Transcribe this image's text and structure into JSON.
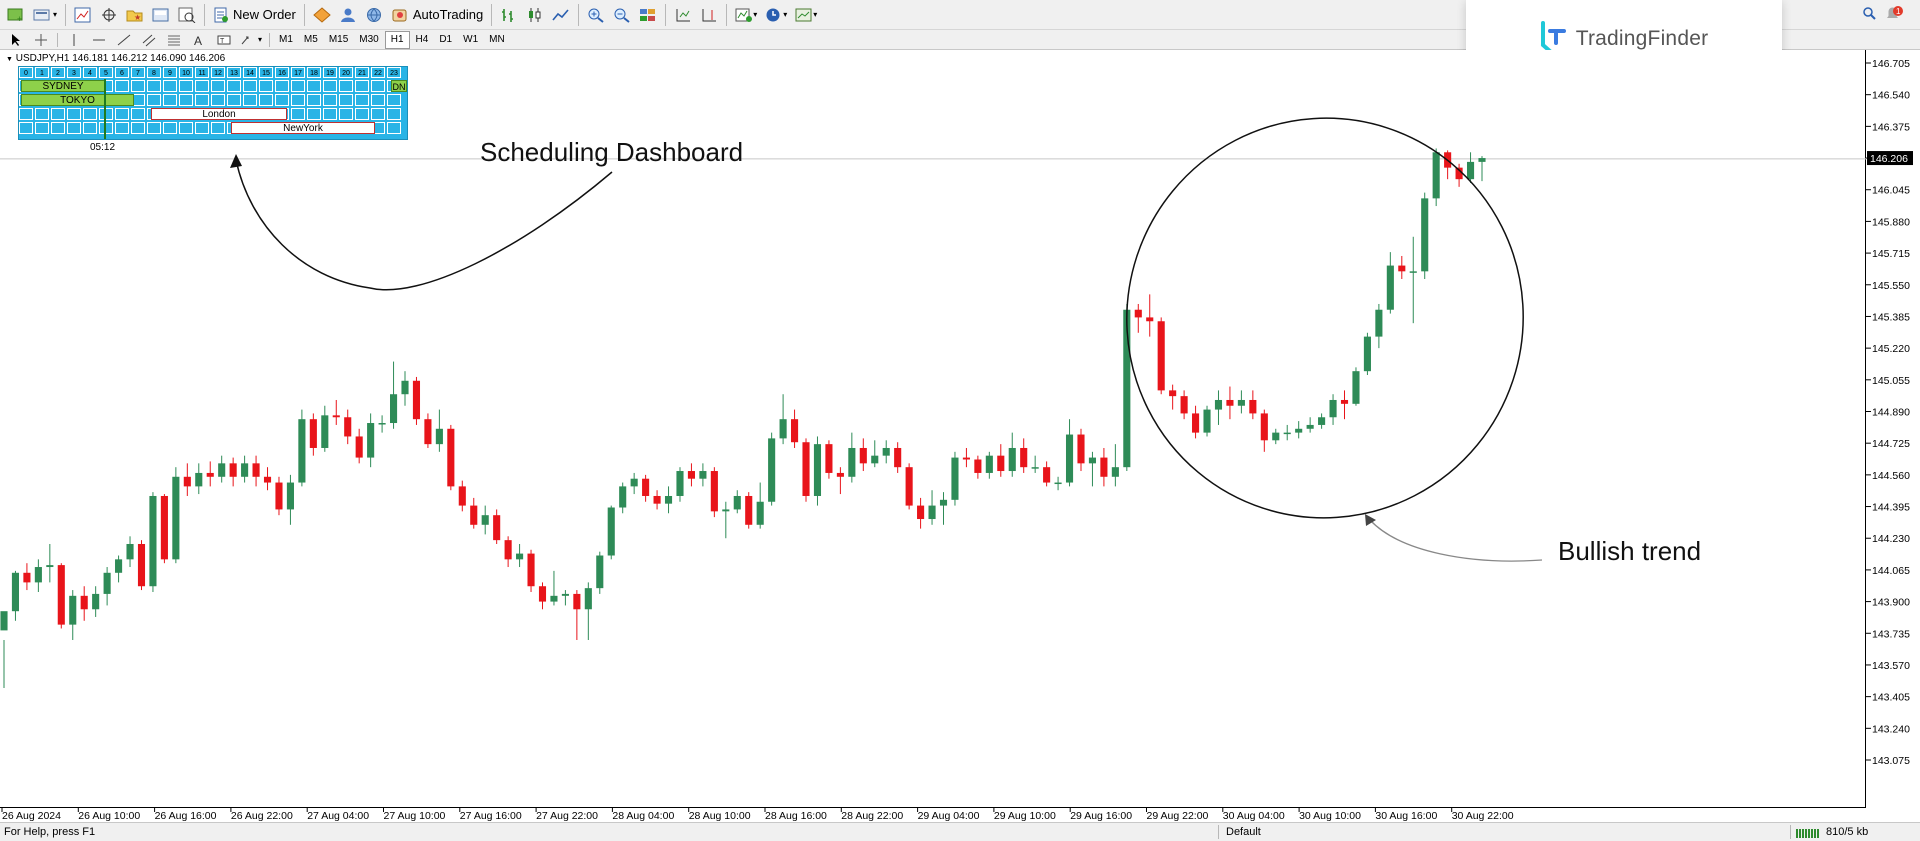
{
  "toolbar": {
    "new_order_label": "New Order",
    "autotrading_label": "AutoTrading",
    "timeframes": [
      "M1",
      "M5",
      "M15",
      "M30",
      "H1",
      "H4",
      "D1",
      "W1",
      "MN"
    ],
    "active_timeframe": "H1",
    "notification_count": "1"
  },
  "logo": {
    "text": "TradingFinder"
  },
  "chart": {
    "symbol_line": "USDJPY,H1  146.181 146.212 146.090 146.206",
    "current_price": "146.206",
    "price_labels": [
      "146.705",
      "146.540",
      "146.375",
      "146.206",
      "146.045",
      "145.880",
      "145.715",
      "145.550",
      "145.385",
      "145.220",
      "145.055",
      "144.890",
      "144.725",
      "144.560",
      "144.395",
      "144.230",
      "144.065",
      "143.900",
      "143.735",
      "143.570",
      "143.405",
      "143.240",
      "143.075"
    ],
    "time_labels": [
      "26 Aug 2024",
      "26 Aug 10:00",
      "26 Aug 16:00",
      "26 Aug 22:00",
      "27 Aug 04:00",
      "27 Aug 10:00",
      "27 Aug 16:00",
      "27 Aug 22:00",
      "28 Aug 04:00",
      "28 Aug 10:00",
      "28 Aug 16:00",
      "28 Aug 22:00",
      "29 Aug 04:00",
      "29 Aug 10:00",
      "29 Aug 16:00",
      "29 Aug 22:00",
      "30 Aug 04:00",
      "30 Aug 10:00",
      "30 Aug 16:00",
      "30 Aug 22:00"
    ],
    "colors": {
      "bull": "#2e8b57",
      "bear": "#e8141a"
    },
    "candles": [
      [
        143.75,
        143.85,
        143.7,
        143.45
      ],
      [
        143.85,
        144.05,
        144.06,
        143.8
      ],
      [
        144.05,
        144.0,
        144.1,
        143.96
      ],
      [
        144.0,
        144.08,
        144.12,
        143.95
      ],
      [
        144.08,
        144.09,
        144.2,
        144.0
      ],
      [
        144.09,
        143.78,
        144.1,
        143.76
      ],
      [
        143.78,
        143.93,
        143.96,
        143.7
      ],
      [
        143.93,
        143.86,
        143.98,
        143.8
      ],
      [
        143.86,
        143.94,
        143.98,
        143.82
      ],
      [
        143.94,
        144.05,
        144.08,
        143.88
      ],
      [
        144.05,
        144.12,
        144.14,
        144.0
      ],
      [
        144.12,
        144.2,
        144.24,
        144.08
      ],
      [
        144.2,
        143.98,
        144.22,
        143.96
      ],
      [
        143.98,
        144.45,
        144.47,
        143.95
      ],
      [
        144.45,
        144.12,
        144.46,
        144.1
      ],
      [
        144.12,
        144.55,
        144.6,
        144.1
      ],
      [
        144.55,
        144.5,
        144.62,
        144.45
      ],
      [
        144.5,
        144.57,
        144.62,
        144.46
      ],
      [
        144.57,
        144.55,
        144.63,
        144.5
      ],
      [
        144.55,
        144.62,
        144.66,
        144.52
      ],
      [
        144.62,
        144.55,
        144.65,
        144.5
      ],
      [
        144.55,
        144.62,
        144.66,
        144.52
      ],
      [
        144.62,
        144.55,
        144.66,
        144.5
      ],
      [
        144.55,
        144.52,
        144.6,
        144.48
      ],
      [
        144.52,
        144.38,
        144.55,
        144.35
      ],
      [
        144.38,
        144.52,
        144.56,
        144.3
      ],
      [
        144.52,
        144.85,
        144.9,
        144.5
      ],
      [
        144.85,
        144.7,
        144.88,
        144.66
      ],
      [
        144.7,
        144.87,
        144.92,
        144.68
      ],
      [
        144.87,
        144.86,
        144.95,
        144.82
      ],
      [
        144.86,
        144.76,
        144.9,
        144.72
      ],
      [
        144.76,
        144.65,
        144.8,
        144.62
      ],
      [
        144.65,
        144.83,
        144.88,
        144.6
      ],
      [
        144.83,
        144.83,
        144.87,
        144.78
      ],
      [
        144.83,
        144.98,
        145.15,
        144.8
      ],
      [
        144.98,
        145.05,
        145.1,
        144.92
      ],
      [
        145.05,
        144.85,
        145.07,
        144.82
      ],
      [
        144.85,
        144.72,
        144.88,
        144.7
      ],
      [
        144.72,
        144.8,
        144.9,
        144.68
      ],
      [
        144.8,
        144.5,
        144.82,
        144.48
      ],
      [
        144.5,
        144.4,
        144.53,
        144.37
      ],
      [
        144.4,
        144.3,
        144.44,
        144.28
      ],
      [
        144.3,
        144.35,
        144.4,
        144.25
      ],
      [
        144.35,
        144.22,
        144.38,
        144.2
      ],
      [
        144.22,
        144.12,
        144.24,
        144.08
      ],
      [
        144.12,
        144.15,
        144.2,
        144.08
      ],
      [
        144.15,
        143.98,
        144.17,
        143.95
      ],
      [
        143.98,
        143.9,
        144.0,
        143.86
      ],
      [
        143.9,
        143.93,
        144.06,
        143.88
      ],
      [
        143.93,
        143.94,
        143.96,
        143.88
      ],
      [
        143.94,
        143.86,
        143.96,
        143.7
      ],
      [
        143.86,
        143.97,
        144.0,
        143.7
      ],
      [
        143.97,
        144.14,
        144.16,
        143.94
      ],
      [
        144.14,
        144.39,
        144.4,
        144.12
      ],
      [
        144.39,
        144.5,
        144.52,
        144.36
      ],
      [
        144.5,
        144.54,
        144.57,
        144.46
      ],
      [
        144.54,
        144.45,
        144.56,
        144.42
      ],
      [
        144.45,
        144.41,
        144.48,
        144.38
      ],
      [
        144.41,
        144.45,
        144.5,
        144.36
      ],
      [
        144.45,
        144.58,
        144.6,
        144.42
      ],
      [
        144.58,
        144.54,
        144.62,
        144.5
      ],
      [
        144.54,
        144.58,
        144.62,
        144.5
      ],
      [
        144.58,
        144.37,
        144.6,
        144.34
      ],
      [
        144.37,
        144.38,
        144.42,
        144.23
      ],
      [
        144.38,
        144.45,
        144.48,
        144.36
      ],
      [
        144.45,
        144.3,
        144.47,
        144.28
      ],
      [
        144.3,
        144.42,
        144.52,
        144.28
      ],
      [
        144.42,
        144.75,
        144.78,
        144.4
      ],
      [
        144.75,
        144.85,
        144.98,
        144.72
      ],
      [
        144.85,
        144.73,
        144.9,
        144.7
      ],
      [
        144.73,
        144.45,
        144.75,
        144.42
      ],
      [
        144.45,
        144.72,
        144.76,
        144.4
      ],
      [
        144.72,
        144.57,
        144.74,
        144.54
      ],
      [
        144.57,
        144.55,
        144.6,
        144.46
      ],
      [
        144.55,
        144.7,
        144.78,
        144.52
      ],
      [
        144.7,
        144.62,
        144.75,
        144.58
      ],
      [
        144.62,
        144.66,
        144.74,
        144.6
      ],
      [
        144.66,
        144.7,
        144.74,
        144.62
      ],
      [
        144.7,
        144.6,
        144.73,
        144.57
      ],
      [
        144.6,
        144.4,
        144.62,
        144.38
      ],
      [
        144.4,
        144.33,
        144.44,
        144.28
      ],
      [
        144.33,
        144.4,
        144.48,
        144.3
      ],
      [
        144.4,
        144.43,
        144.47,
        144.3
      ],
      [
        144.43,
        144.65,
        144.68,
        144.4
      ],
      [
        144.65,
        144.64,
        144.7,
        144.6
      ],
      [
        144.64,
        144.57,
        144.66,
        144.54
      ],
      [
        144.57,
        144.66,
        144.68,
        144.54
      ],
      [
        144.66,
        144.58,
        144.72,
        144.55
      ],
      [
        144.58,
        144.7,
        144.78,
        144.55
      ],
      [
        144.7,
        144.6,
        144.75,
        144.57
      ],
      [
        144.6,
        144.6,
        144.66,
        144.57
      ],
      [
        144.6,
        144.52,
        144.63,
        144.5
      ],
      [
        144.52,
        144.52,
        144.55,
        144.48
      ],
      [
        144.52,
        144.77,
        144.85,
        144.5
      ],
      [
        144.77,
        144.62,
        144.8,
        144.58
      ],
      [
        144.62,
        144.65,
        144.68,
        144.5
      ],
      [
        144.65,
        144.55,
        144.7,
        144.5
      ],
      [
        144.55,
        144.6,
        144.72,
        144.5
      ],
      [
        144.6,
        145.42,
        145.45,
        144.58
      ],
      [
        145.42,
        145.38,
        145.45,
        145.3
      ],
      [
        145.38,
        145.36,
        145.5,
        145.28
      ],
      [
        145.36,
        145.0,
        145.38,
        144.98
      ],
      [
        145.0,
        144.97,
        145.03,
        144.9
      ],
      [
        144.97,
        144.88,
        145.0,
        144.85
      ],
      [
        144.88,
        144.78,
        144.92,
        144.75
      ],
      [
        144.78,
        144.9,
        144.92,
        144.76
      ],
      [
        144.9,
        144.95,
        145.0,
        144.82
      ],
      [
        144.95,
        144.92,
        145.02,
        144.85
      ],
      [
        144.92,
        144.95,
        145.0,
        144.88
      ],
      [
        144.95,
        144.88,
        145.0,
        144.85
      ],
      [
        144.88,
        144.74,
        144.9,
        144.68
      ],
      [
        144.74,
        144.78,
        144.8,
        144.72
      ],
      [
        144.78,
        144.78,
        144.82,
        144.74
      ],
      [
        144.78,
        144.8,
        144.84,
        144.75
      ],
      [
        144.8,
        144.82,
        144.86,
        144.78
      ],
      [
        144.82,
        144.86,
        144.88,
        144.8
      ],
      [
        144.86,
        144.95,
        144.98,
        144.82
      ],
      [
        144.95,
        144.93,
        145.0,
        144.85
      ],
      [
        144.93,
        145.1,
        145.12,
        144.92
      ],
      [
        145.1,
        145.28,
        145.3,
        145.08
      ],
      [
        145.28,
        145.42,
        145.45,
        145.22
      ],
      [
        145.42,
        145.65,
        145.72,
        145.4
      ],
      [
        145.65,
        145.62,
        145.7,
        145.58
      ],
      [
        145.62,
        145.62,
        145.8,
        145.35
      ],
      [
        145.62,
        146.0,
        146.03,
        145.58
      ],
      [
        146.0,
        146.24,
        146.26,
        145.96
      ],
      [
        146.24,
        146.16,
        146.25,
        146.1
      ],
      [
        146.16,
        146.1,
        146.18,
        146.06
      ],
      [
        146.1,
        146.19,
        146.24,
        146.08
      ],
      [
        146.19,
        146.21,
        146.22,
        146.09
      ]
    ]
  },
  "dashboard": {
    "hours": [
      "0",
      "1",
      "2",
      "3",
      "4",
      "5",
      "6",
      "7",
      "8",
      "9",
      "10",
      "11",
      "12",
      "13",
      "14",
      "15",
      "16",
      "17",
      "18",
      "19",
      "20",
      "21",
      "22",
      "23"
    ],
    "sessions": {
      "sydney": "SYDNEY",
      "tokyo": "TOKYO",
      "london": "London",
      "newyork": "NewYork"
    },
    "badge": "DN",
    "time_label": "05:12"
  },
  "annotations": {
    "dashboard_label": "Scheduling Dashboard",
    "trend_label": "Bullish trend"
  },
  "status": {
    "help": "For Help, press F1",
    "profile": "Default",
    "connection": "810/5 kb"
  }
}
